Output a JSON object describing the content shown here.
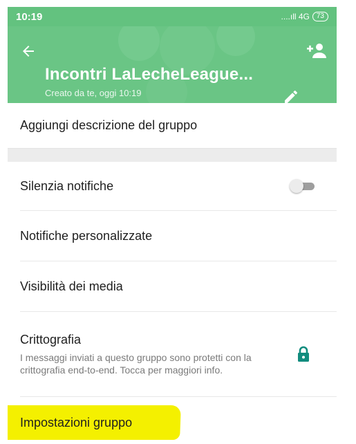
{
  "status_bar": {
    "time": "10:19",
    "signal": "....ıll 4G",
    "battery": "73"
  },
  "header": {
    "title": "Incontri LaLecheLeague...",
    "subtitle": "Creato da te, oggi 10:19",
    "back_icon": "arrow-left-icon",
    "add_icon": "person-add-icon",
    "edit_icon": "pencil-icon",
    "color": "#6ac585"
  },
  "rows": {
    "description": "Aggiungi descrizione del gruppo",
    "mute": "Silenzia notifiche",
    "mute_enabled": false,
    "custom_notifications": "Notifiche personalizzate",
    "media_visibility": "Visibilità dei media",
    "encryption_title": "Crittografia",
    "encryption_desc": "I messaggi inviati a questo gruppo sono protetti con la crittografia end-to-end. Tocca per maggiori info.",
    "group_settings": "Impostazioni gruppo"
  },
  "accent": "#128c7e",
  "highlight_color": "#f4f000"
}
